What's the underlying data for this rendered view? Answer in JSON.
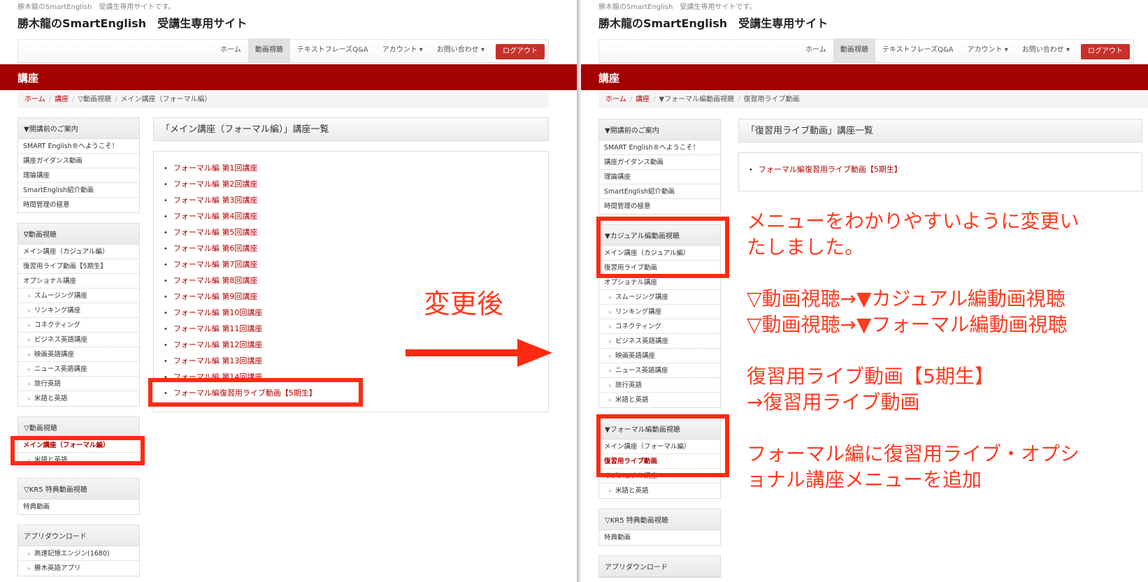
{
  "site": {
    "tagline": "勝木龍のSmartEnglish　受講生専用サイトです。",
    "title": "勝木龍のSmartEnglish　受講生専用サイト"
  },
  "nav": {
    "items": [
      "ホーム",
      "動画視聴",
      "テキストフレーズQ&A",
      "アカウント ▾",
      "お問い合わせ ▾"
    ],
    "active": "動画視聴",
    "logout": "ログアウト"
  },
  "section_title": "講座",
  "before": {
    "breadcrumb": [
      "ホーム",
      "講座",
      "▽動画視聴",
      "メイン講座（フォーマル編）"
    ],
    "sidebar": [
      {
        "head": "▼開講前のご案内",
        "items": [
          {
            "label": "SMART English®へようこそ！"
          },
          {
            "label": "講座ガイダンス動画"
          },
          {
            "label": "理論講座"
          },
          {
            "label": "SmartEnglish紹介動画"
          },
          {
            "label": "時間管理の極意"
          }
        ]
      },
      {
        "head": "∇動画視聴",
        "items": [
          {
            "label": "メイン講座（カジュアル編）"
          },
          {
            "label": "復習用ライブ動画【5期生】"
          },
          {
            "label": "オプショナル講座"
          },
          {
            "label": "スムージング講座",
            "sub": true
          },
          {
            "label": "リンキング講座",
            "sub": true
          },
          {
            "label": "コネクティング",
            "sub": true
          },
          {
            "label": "ビジネス英語講座",
            "sub": true
          },
          {
            "label": "映画英語講座",
            "sub": true
          },
          {
            "label": "ニュース英語講座",
            "sub": true
          },
          {
            "label": "旅行英語",
            "sub": true
          },
          {
            "label": "米語と英語",
            "sub": true
          }
        ]
      },
      {
        "head": "▽動画視聴",
        "items": [
          {
            "label": "メイン講座（フォーマル編）",
            "active": true
          },
          {
            "label": "米語と英語",
            "sub": true
          }
        ]
      },
      {
        "head": "▽KR5 特典動画視聴",
        "items": [
          {
            "label": "特典動画"
          }
        ]
      },
      {
        "head": "アプリダウンロード",
        "items": [
          {
            "label": "高速記憶エンジン(1680)",
            "sub": true
          },
          {
            "label": "勝木英語アプリ",
            "sub": true
          }
        ]
      }
    ],
    "main_title": "「メイン講座（フォーマル編）」講座一覧",
    "list": [
      "フォーマル編 第1回講座",
      "フォーマル編 第2回講座",
      "フォーマル編 第3回講座",
      "フォーマル編 第4回講座",
      "フォーマル編 第5回講座",
      "フォーマル編 第6回講座",
      "フォーマル編 第7回講座",
      "フォーマル編 第8回講座",
      "フォーマル編 第9回講座",
      "フォーマル編 第10回講座",
      "フォーマル編 第11回講座",
      "フォーマル編 第12回講座",
      "フォーマル編 第13回講座",
      "フォーマル編 第14回講座",
      "フォーマル編復習用ライブ動画【5期生】"
    ]
  },
  "after": {
    "breadcrumb": [
      "ホーム",
      "講座",
      "▼フォーマル編動画視聴",
      "復習用ライブ動画"
    ],
    "sidebar": [
      {
        "head": "▼開講前のご案内",
        "items": [
          {
            "label": "SMART English®へようこそ！"
          },
          {
            "label": "講座ガイダンス動画"
          },
          {
            "label": "理論講座"
          },
          {
            "label": "SmartEnglish紹介動画"
          },
          {
            "label": "時間管理の極意"
          }
        ]
      },
      {
        "head": "▼カジュアル編動画視聴",
        "items": [
          {
            "label": "メイン講座（カジュアル編）"
          },
          {
            "label": "復習用ライブ動画"
          },
          {
            "label": "オプショナル講座"
          },
          {
            "label": "スムージング講座",
            "sub": true
          },
          {
            "label": "リンキング講座",
            "sub": true
          },
          {
            "label": "コネクティング",
            "sub": true
          },
          {
            "label": "ビジネス英語講座",
            "sub": true
          },
          {
            "label": "映画英語講座",
            "sub": true
          },
          {
            "label": "ニュース英語講座",
            "sub": true
          },
          {
            "label": "旅行英語",
            "sub": true
          },
          {
            "label": "米語と英語",
            "sub": true
          }
        ]
      },
      {
        "head": "▼フォーマル編動画視聴",
        "items": [
          {
            "label": "メイン講座（フォーマル編）"
          },
          {
            "label": "復習用ライブ動画",
            "active": true
          },
          {
            "label": "オプショナル講座"
          },
          {
            "label": "米語と英語",
            "sub": true
          }
        ]
      },
      {
        "head": "▽KR5 特典動画視聴",
        "items": [
          {
            "label": "特典動画"
          }
        ]
      },
      {
        "head": "アプリダウンロード",
        "items": []
      }
    ],
    "main_title": "「復習用ライブ動画」講座一覧",
    "list": [
      "フォーマル編復習用ライブ動画【5期生】"
    ]
  },
  "annotation": {
    "arrow_label": "変更後",
    "notes": [
      [
        "メニューをわかりやすいように変更い",
        "たしました。"
      ],
      [
        "▽動画視聴→▼カジュアル編動画視聴",
        "▽動画視聴→▼フォーマル編動画視聴"
      ],
      [
        "復習用ライブ動画【5期生】",
        "→復習用ライブ動画"
      ],
      [
        "フォーマル編に復習用ライブ・オプシ",
        "ョナル講座メニューを追加"
      ]
    ]
  },
  "colors": {
    "brand_red": "#a30000",
    "link_red": "#b40000",
    "annotation_red": "#ff2a12"
  }
}
